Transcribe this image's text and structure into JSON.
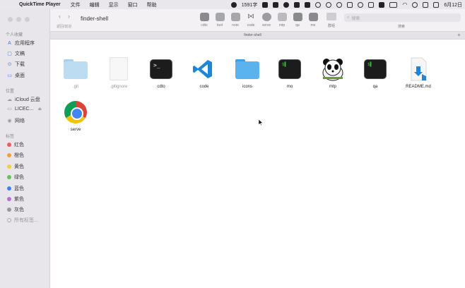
{
  "menubar": {
    "app_name": "QuickTime Player",
    "menus": [
      "文件",
      "编辑",
      "显示",
      "窗口",
      "帮助"
    ],
    "word_count": "1591字",
    "date": "6月12日"
  },
  "sidebar": {
    "favorites_title": "个人收藏",
    "favorites": [
      {
        "label": "应用程序",
        "icon": "apps-icon"
      },
      {
        "label": "文稿",
        "icon": "document-icon"
      },
      {
        "label": "下载",
        "icon": "download-icon"
      },
      {
        "label": "桌面",
        "icon": "desktop-icon"
      }
    ],
    "locations_title": "位置",
    "locations": [
      {
        "label": "iCloud 云盘",
        "icon": "cloud-icon"
      },
      {
        "label": "LICEC...",
        "icon": "disk-icon"
      },
      {
        "label": "网络",
        "icon": "network-icon"
      }
    ],
    "tags_title": "标签",
    "tags": [
      {
        "label": "红色",
        "color": "#f05b57"
      },
      {
        "label": "橙色",
        "color": "#f6a03c"
      },
      {
        "label": "黄色",
        "color": "#f6cf3d"
      },
      {
        "label": "绿色",
        "color": "#62c554"
      },
      {
        "label": "蓝色",
        "color": "#3b82f0"
      },
      {
        "label": "紫色",
        "color": "#b66fd4"
      },
      {
        "label": "灰色",
        "color": "#9a9a9e"
      },
      {
        "label": "所有标签..."
      }
    ]
  },
  "toolbar": {
    "nav_label": "返回/前进",
    "title": "finder-shell",
    "apps": [
      "cdto",
      "tool",
      "note",
      "code",
      "serve",
      "mtp",
      "qa",
      "mo"
    ],
    "group_label": "群组",
    "search_placeholder": "搜索",
    "search_label": "搜索"
  },
  "tab": {
    "title": "finder-shell"
  },
  "files": [
    {
      "name": ".git",
      "kind": "folder-light",
      "dim": true
    },
    {
      "name": ".gitignore",
      "kind": "doc",
      "dim": true
    },
    {
      "name": "cdto",
      "kind": "terminal"
    },
    {
      "name": "code",
      "kind": "vscode"
    },
    {
      "name": "icons",
      "kind": "folder"
    },
    {
      "name": "mo",
      "kind": "terminal-green"
    },
    {
      "name": "mtp",
      "kind": "panda"
    },
    {
      "name": "qa",
      "kind": "terminal-green"
    },
    {
      "name": "README.md",
      "kind": "markdown"
    },
    {
      "name": "serve",
      "kind": "chrome"
    }
  ],
  "colors": {
    "folder": "#5ab3ef",
    "folder_light": "#bcdcf2",
    "accent": "#3b7be0"
  }
}
